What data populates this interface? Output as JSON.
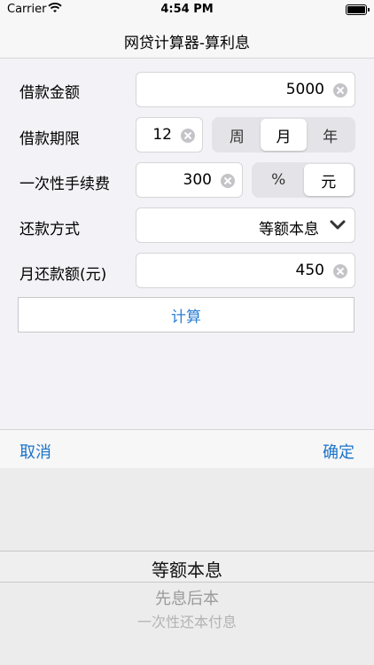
{
  "status_bar": {
    "carrier": "Carrier",
    "time": "4:54 PM"
  },
  "nav": {
    "title": "网贷计算器-算利息"
  },
  "form": {
    "loan_amount": {
      "label": "借款金额",
      "value": "5000"
    },
    "loan_term": {
      "label": "借款期限",
      "value": "12",
      "units": [
        "周",
        "月",
        "年"
      ],
      "selected_unit": "月"
    },
    "fee": {
      "label": "一次性手续费",
      "value": "300",
      "units": [
        "%",
        "元"
      ],
      "selected_unit": "元"
    },
    "repay_method": {
      "label": "还款方式",
      "value": "等额本息"
    },
    "monthly_payment": {
      "label": "月还款额(元)",
      "value": "450"
    },
    "calculate_label": "计算"
  },
  "picker": {
    "cancel_label": "取消",
    "confirm_label": "确定",
    "options": [
      "等额本息",
      "先息后本",
      "一次性还本付息"
    ],
    "selected": "等额本息"
  },
  "colors": {
    "accent": "#1a73c9",
    "button_text": "#2a7ed6",
    "background": "#f2f2f7"
  }
}
